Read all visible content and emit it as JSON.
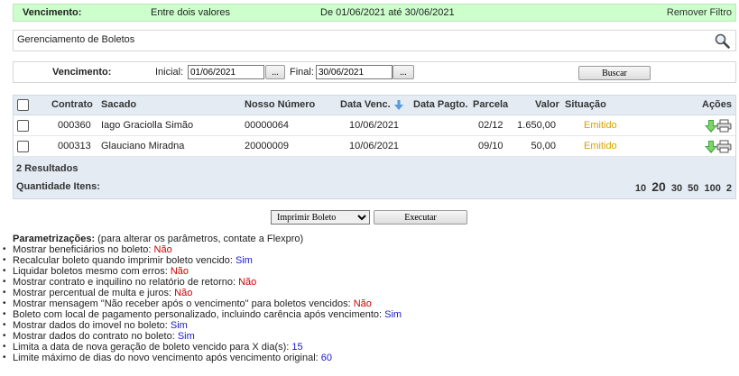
{
  "filter": {
    "label": "Vencimento:",
    "type_value": "Entre dois valores",
    "range_value": "De 01/06/2021 até 30/06/2021",
    "remove_label": "Remover Filtro"
  },
  "title": "Gerenciamento de Boletos",
  "form": {
    "label": "Vencimento:",
    "initial_label": "Inicial:",
    "initial_value": "01/06/2021",
    "final_label": "Final:",
    "final_value": "30/06/2021",
    "picker_label": "...",
    "search_label": "Buscar"
  },
  "table": {
    "headers": {
      "contrato": "Contrato",
      "sacado": "Sacado",
      "nosso_numero": "Nosso Número",
      "data_venc": "Data Venc.",
      "data_pagto": "Data Pagto.",
      "parcela": "Parcela",
      "valor": "Valor",
      "situacao": "Situação",
      "acoes": "Ações"
    },
    "rows": [
      {
        "contrato": "000360",
        "sacado": "Iago Graciolla Simão",
        "nosso_numero": "00000064",
        "data_venc": "10/06/2021",
        "data_pagto": "",
        "parcela": "02/12",
        "valor": "1.650,00",
        "situacao": "Emitido"
      },
      {
        "contrato": "000313",
        "sacado": "Glauciano Miradna",
        "nosso_numero": "20000009",
        "data_venc": "10/06/2021",
        "data_pagto": "",
        "parcela": "09/10",
        "valor": "50,00",
        "situacao": "Emitido"
      }
    ],
    "results": "2 Resultados",
    "quantity_label": "Quantidade Itens:",
    "page_sizes": [
      "10",
      "20",
      "30",
      "50",
      "100",
      "2"
    ],
    "selected_page_size": "20"
  },
  "actions": {
    "select_value": "Imprimir Boleto",
    "execute_label": "Executar"
  },
  "params": {
    "heading": "Parametrizações:",
    "heading_note": " (para alterar os parâmetros, contate a Flexpro)",
    "items": [
      {
        "text": "Mostrar beneficiários no boleto: ",
        "value": "Não"
      },
      {
        "text": "Recalcular boleto quando imprimir boleto vencido: ",
        "value": "Sim"
      },
      {
        "text": "Liquidar boletos mesmo com erros: ",
        "value": "Não"
      },
      {
        "text": "Mostrar contrato e inquilino no relatório de retorno: ",
        "value": "Não"
      },
      {
        "text": "Mostrar percentual de multa e juros: ",
        "value": "Não"
      },
      {
        "text": "Mostrar mensagem \"Não receber após o vencimento\" para boletos vencidos: ",
        "value": "Não"
      },
      {
        "text": "Boleto com local de pagamento personalizado, incluindo carência após vencimento: ",
        "value": "Sim"
      },
      {
        "text": "Mostrar dados do imovel no boleto: ",
        "value": "Sim"
      },
      {
        "text": "Mostrar dados do contrato no boleto: ",
        "value": "Sim"
      },
      {
        "text": "Limita a data de nova geração de boleto vencido para X dia(s): ",
        "value": "15"
      },
      {
        "text": "Limite máximo de dias do novo vencimento após vencimento original: ",
        "value": "60"
      }
    ]
  },
  "colors": {
    "filter_bg": "#ccffcc",
    "header_bg": "#e4ebf3",
    "status": "#d6a300",
    "no": "#cc0000",
    "yes": "#1a1acc"
  }
}
